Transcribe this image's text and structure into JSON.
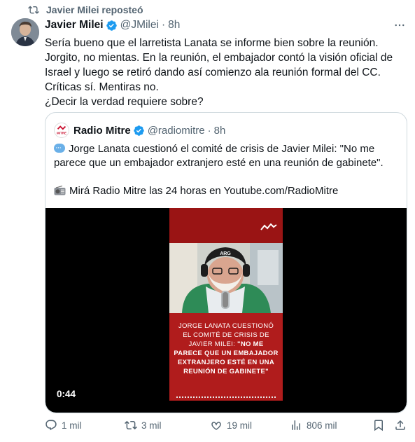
{
  "repost": {
    "label": "Javier Milei reposteó",
    "icon": "repost-icon"
  },
  "tweet": {
    "author_name": "Javier Milei",
    "handle": "@JMilei",
    "separator": "·",
    "time": "8h",
    "lines": [
      "Sería bueno que el larretista Lanata se informe bien sobre la reunión.",
      "Jorgito, no mientas. En la reunión, el embajador contó la visión oficial de",
      "Israel y luego se retiró dando así comienzo ala reunión formal del CC.",
      "Críticas sí. Mentiras no.",
      "¿Decir la verdad requiere sobre?"
    ]
  },
  "quote": {
    "author_name": "Radio Mitre",
    "handle": "@radiomitre",
    "separator": "·",
    "time": "8h",
    "line1": "Jorge Lanata cuestionó el comité de crisis de Javier Milei: \"No me",
    "line2": "parece que un embajador extranjero esté en una reunión de gabinete\".",
    "line3": "Mirá Radio Mitre las 24 horas en Youtube.com/RadioMitre",
    "logo_text": "MITRE"
  },
  "video": {
    "duration": "0:44",
    "caption_normal_1": "JORGE LANATA CUESTIONÓ",
    "caption_normal_2": "EL COMITÉ DE CRISIS DE",
    "caption_normal_3": "JAVIER MILEI: ",
    "caption_bold_3": "\"NO ME",
    "caption_bold_4": "PARECE QUE UN EMBAJADOR",
    "caption_bold_5": "EXTRANJERO ESTÉ EN UNA",
    "caption_bold_6": "REUNIÓN DE GABINETE\""
  },
  "actions": {
    "replies": "1 mil",
    "reposts": "3 mil",
    "likes": "19 mil",
    "views": "806 mil"
  },
  "colors": {
    "verified": "#1d9bf0",
    "muted": "#536471",
    "text": "#0f1419",
    "video_red": "#b01c1c"
  }
}
